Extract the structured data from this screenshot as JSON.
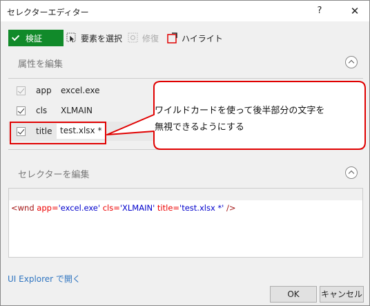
{
  "window": {
    "title": "セレクターエディター",
    "help": "?",
    "close": "✕"
  },
  "toolbar": {
    "validate_label": "検証",
    "select_element_label": "要素を選択",
    "repair_label": "修復",
    "highlight_label": "ハイライト"
  },
  "attributes": {
    "section_title": "属性を編集",
    "rows": [
      {
        "name": "app",
        "value": "excel.exe",
        "checked": true,
        "enabled": false
      },
      {
        "name": "cls",
        "value": "XLMAIN",
        "checked": true,
        "enabled": true
      },
      {
        "name": "title",
        "value": "test.xlsx *",
        "checked": true,
        "enabled": true
      }
    ]
  },
  "callout": {
    "line1": "ワイルドカードを使って後半部分の文字を",
    "line2": "無視できるようにする"
  },
  "selector": {
    "section_title": "セレクターを編集",
    "code": {
      "open": "<wnd ",
      "attr1": "app=",
      "val1": "'excel.exe'",
      "attr2": " cls=",
      "val2": "'XLMAIN'",
      "attr3": " title=",
      "val3": "'test.xlsx *'",
      "close": " />"
    }
  },
  "footer": {
    "explorer_link": "UI Explorer で開く",
    "ok_label": "OK",
    "cancel_label": "キャンセル"
  },
  "colors": {
    "validate_green": "#118a2a",
    "highlight_red": "#e00000",
    "link_blue": "#2e74c0"
  }
}
